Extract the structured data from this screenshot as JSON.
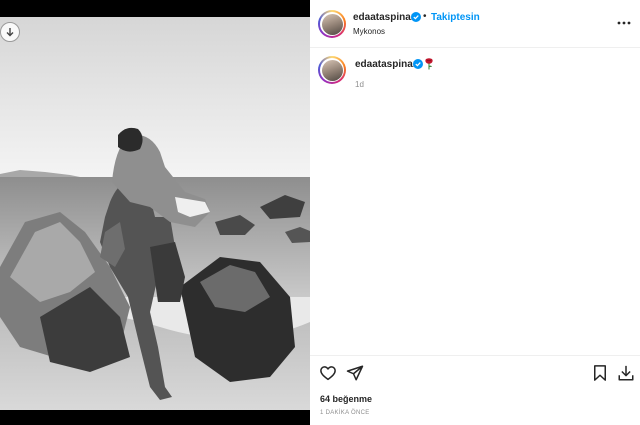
{
  "post": {
    "username": "edaataspinar",
    "follow_status": "Takiptesin",
    "location": "Mykonos",
    "separator": "•"
  },
  "caption": {
    "username": "edaataspinar",
    "emoji": "rose-emoji",
    "time_ago": "1d"
  },
  "engagement": {
    "likes": "64 beğenme",
    "timestamp": "1 DAKİKA ÖNCE"
  },
  "icons": {
    "download": "download-icon",
    "more": "more-options-icon",
    "like": "heart-icon",
    "share": "send-icon",
    "save": "bookmark-icon",
    "save_download": "save-download-icon",
    "verified": "verified-badge-icon"
  },
  "colors": {
    "verified_blue": "#0095f6",
    "follow_blue": "#0095f6",
    "rose_red": "#c0162c"
  }
}
